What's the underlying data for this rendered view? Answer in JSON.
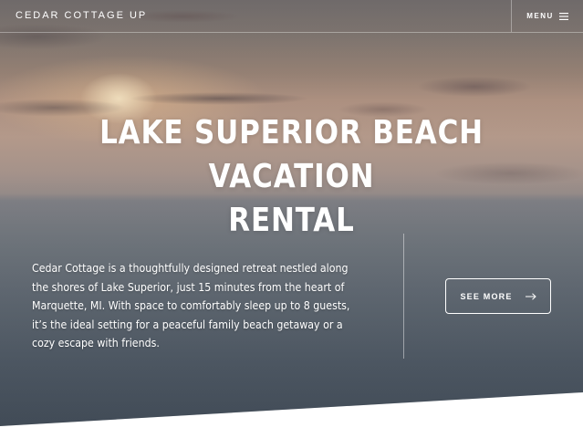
{
  "header": {
    "brand": "CEDAR COTTAGE UP",
    "menu_label": "MENU",
    "menu_icon": "hamburger-icon"
  },
  "hero": {
    "title_line1": "LAKE SUPERIOR BEACH VACATION",
    "title_line2": "RENTAL",
    "description": "Cedar Cottage is a thoughtfully designed retreat nestled along the shores of Lake Superior, just 15 minutes from the heart of Marquette, MI. With space to comfortably sleep up to 8 guests, it’s the ideal setting for a peaceful family beach getaway or a cozy escape with friends.",
    "cta_label": "SEE MORE",
    "cta_icon": "arrow-right-icon"
  },
  "colors": {
    "text": "#ffffff",
    "page_background": "#ffffff"
  }
}
